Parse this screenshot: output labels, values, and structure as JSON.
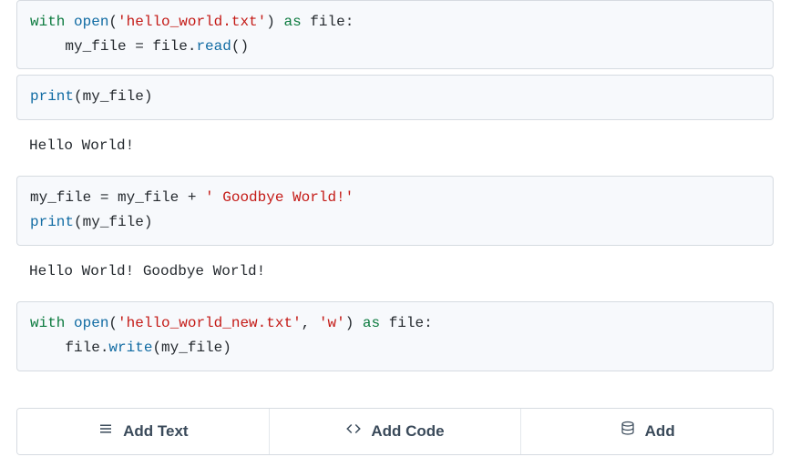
{
  "cells": [
    {
      "type": "code",
      "tokens": [
        {
          "t": "kw",
          "v": "with"
        },
        {
          "t": "sp",
          "v": " "
        },
        {
          "t": "builtin",
          "v": "open"
        },
        {
          "t": "name",
          "v": "("
        },
        {
          "t": "str",
          "v": "'hello_world.txt'"
        },
        {
          "t": "name",
          "v": ") "
        },
        {
          "t": "kw",
          "v": "as"
        },
        {
          "t": "sp",
          "v": " "
        },
        {
          "t": "name",
          "v": "file:"
        },
        {
          "t": "nl",
          "v": "\n"
        },
        {
          "t": "sp",
          "v": "    "
        },
        {
          "t": "name",
          "v": "my_file = file."
        },
        {
          "t": "builtin",
          "v": "read"
        },
        {
          "t": "name",
          "v": "()"
        }
      ]
    },
    {
      "type": "code",
      "tokens": [
        {
          "t": "builtin",
          "v": "print"
        },
        {
          "t": "name",
          "v": "(my_file)"
        }
      ]
    },
    {
      "type": "output",
      "text": "Hello World!"
    },
    {
      "type": "code",
      "tokens": [
        {
          "t": "name",
          "v": "my_file = my_file + "
        },
        {
          "t": "str",
          "v": "' Goodbye World!'"
        },
        {
          "t": "nl",
          "v": "\n"
        },
        {
          "t": "builtin",
          "v": "print"
        },
        {
          "t": "name",
          "v": "(my_file)"
        }
      ]
    },
    {
      "type": "output",
      "text": "Hello World! Goodbye World!"
    },
    {
      "type": "code",
      "tokens": [
        {
          "t": "kw",
          "v": "with"
        },
        {
          "t": "sp",
          "v": " "
        },
        {
          "t": "builtin",
          "v": "open"
        },
        {
          "t": "name",
          "v": "("
        },
        {
          "t": "str",
          "v": "'hello_world_new.txt'"
        },
        {
          "t": "name",
          "v": ", "
        },
        {
          "t": "str",
          "v": "'w'"
        },
        {
          "t": "name",
          "v": ") "
        },
        {
          "t": "kw",
          "v": "as"
        },
        {
          "t": "sp",
          "v": " "
        },
        {
          "t": "name",
          "v": "file:"
        },
        {
          "t": "nl",
          "v": "\n"
        },
        {
          "t": "sp",
          "v": "    "
        },
        {
          "t": "name",
          "v": "file."
        },
        {
          "t": "builtin",
          "v": "write"
        },
        {
          "t": "name",
          "v": "(my_file)"
        }
      ]
    }
  ],
  "toolbar": {
    "add_text": "Add Text",
    "add_code": "Add Code",
    "add_data": "Add"
  }
}
